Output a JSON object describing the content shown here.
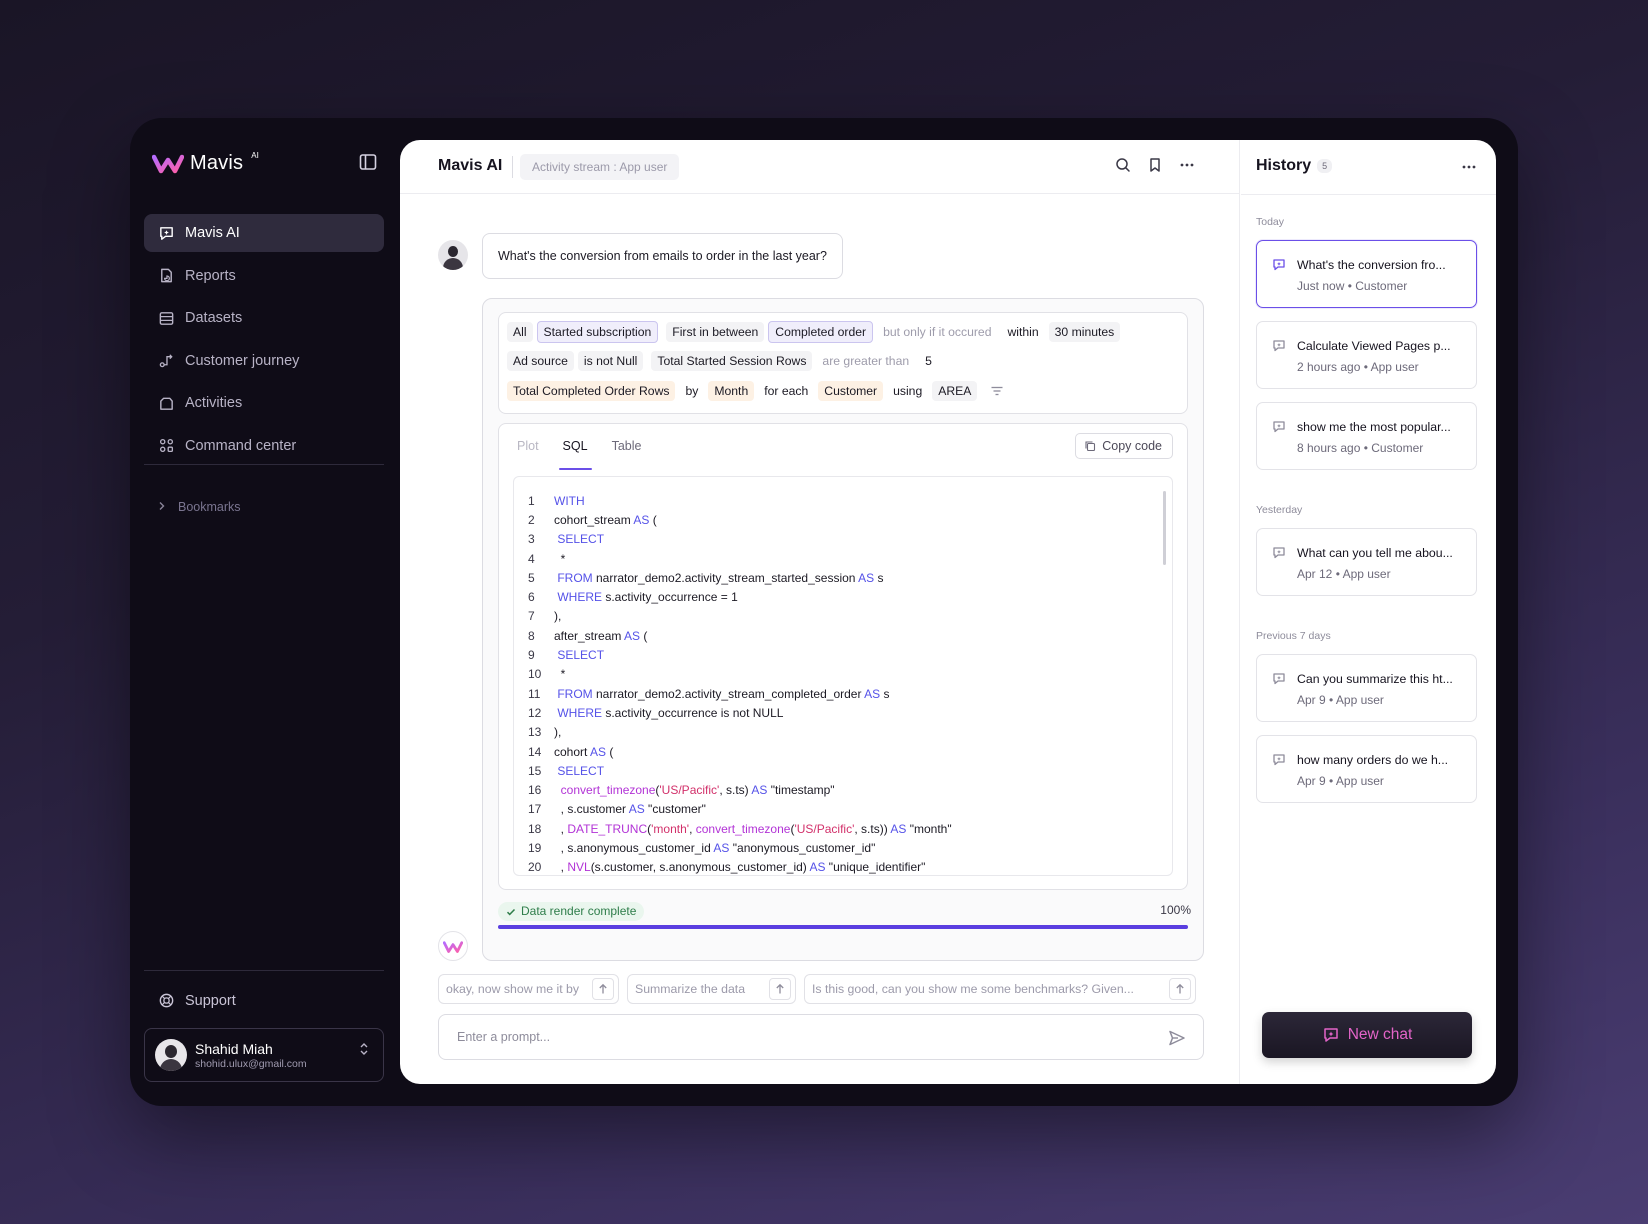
{
  "brand": {
    "name": "Mavis",
    "superscript": "AI"
  },
  "sidebar": {
    "items": [
      {
        "label": "Mavis AI",
        "icon": "ai-chat-icon",
        "active": true
      },
      {
        "label": "Reports",
        "icon": "reports-icon",
        "active": false
      },
      {
        "label": "Datasets",
        "icon": "datasets-icon",
        "active": false
      },
      {
        "label": "Customer journey",
        "icon": "journey-icon",
        "active": false
      },
      {
        "label": "Activities",
        "icon": "activities-icon",
        "active": false
      },
      {
        "label": "Command center",
        "icon": "command-center-icon",
        "active": false
      }
    ],
    "bookmarks_label": "Bookmarks",
    "support_label": "Support",
    "user": {
      "name": "Shahid Miah",
      "email": "shohid.ulux@gmail.com"
    }
  },
  "topbar": {
    "title": "Mavis AI",
    "context": "Activity stream : App user"
  },
  "conversation": {
    "user_message": "What's the conversion from emails to order in the last year?",
    "query": {
      "row1": [
        "All",
        "Started subscription",
        "First in between",
        "Completed order",
        "but only if it occured",
        "within",
        "30 minutes"
      ],
      "row2": [
        "Ad source",
        "is not Null",
        "Total Started Session Rows",
        "are greater than",
        "5"
      ],
      "row3": [
        "Total Completed Order Rows",
        "by",
        "Month",
        "for each",
        "Customer",
        "using",
        "AREA"
      ]
    },
    "tabs": [
      "Plot",
      "SQL",
      "Table"
    ],
    "active_tab": "SQL",
    "copy_label": "Copy code",
    "code": {
      "line_numbers": [
        "1",
        "2",
        "3",
        "4",
        "5",
        "6",
        "7",
        "8",
        "9",
        "10",
        "11",
        "12",
        "13",
        "14",
        "15",
        "16",
        "17",
        "18",
        "19",
        "20"
      ]
    },
    "status": {
      "label": "Data render complete",
      "percent_label": "100%",
      "progress": 1.0
    }
  },
  "suggestions": [
    "okay, now show me it by",
    "Summarize the data",
    "Is this good, can you show me some benchmarks? Given..."
  ],
  "prompt": {
    "placeholder": "Enter a prompt..."
  },
  "history": {
    "title": "History",
    "count": "5",
    "groups": [
      {
        "label": "Today",
        "items": [
          {
            "title": "What's the conversion fro...",
            "meta": "Just now • Customer",
            "active": true
          },
          {
            "title": "Calculate Viewed Pages p...",
            "meta": "2 hours ago • App user"
          },
          {
            "title": "show me the most popular...",
            "meta": "8 hours ago • Customer"
          }
        ]
      },
      {
        "label": "Yesterday",
        "items": [
          {
            "title": "What can you tell me abou...",
            "meta": "Apr 12 • App user"
          }
        ]
      },
      {
        "label": "Previous 7 days",
        "items": [
          {
            "title": "Can you summarize this ht...",
            "meta": "Apr 9 • App user"
          },
          {
            "title": "how many orders do we h...",
            "meta": "Apr 9 • App user"
          }
        ]
      }
    ],
    "new_chat_label": "New chat"
  },
  "colors": {
    "accent": "#6b4fe8",
    "brand_pink": "#e364c8",
    "keyword": "#5552e8",
    "function": "#b233d6",
    "string": "#d2306a"
  }
}
